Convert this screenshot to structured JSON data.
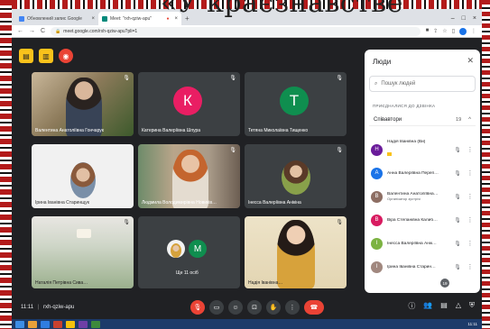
{
  "heading_overlay": "«У краєзнавстве",
  "browser": {
    "tabs": [
      {
        "label": "Обновлений запис Google",
        "active": false,
        "color": "#4285f4"
      },
      {
        "label": "Meet: \"rxh-qziw-apu\"",
        "active": true,
        "color": "#00897b"
      }
    ],
    "url": "meet.google.com/rxh-qziw-apu?pli=1"
  },
  "tiles": [
    {
      "name": "Валентина Анатоліївна Гончарук",
      "type": "video"
    },
    {
      "name": "Катерина Валеріївна Шпура",
      "type": "avatar",
      "initial": "К",
      "color": "#e91e63"
    },
    {
      "name": "Тетяна Миколаївна Тищенко",
      "type": "avatar",
      "initial": "Т",
      "color": "#0f8e4f"
    },
    {
      "name": "Ірина Іванівна Старинщук",
      "type": "video"
    },
    {
      "name": "Людмила Володимирівна Новиків…",
      "type": "video"
    },
    {
      "name": "Інесса Валеріївна Анікіна",
      "type": "video"
    },
    {
      "name": "Наталія Петрівна Сива…",
      "type": "video"
    },
    {
      "name": "Ще 11 осіб",
      "type": "more",
      "initial": "M",
      "color": "#0f8e4f"
    },
    {
      "name": "Надія Іванівна…",
      "type": "video"
    }
  ],
  "panel": {
    "title": "Люди",
    "search_placeholder": "Пошук людей",
    "section": "ПРИЄДНАЛИСЯ ДО ДЗВІНКА",
    "group_label": "Співавтори",
    "group_count": "19",
    "people": [
      {
        "name": "Надія Іванівна (Ви)",
        "initial": "Н",
        "color": "#6a1b9a",
        "host": true
      },
      {
        "name": "Анна Валеріївна Переп…",
        "initial": "А",
        "color": "#1a73e8"
      },
      {
        "name": "Валентина Анатоліївна…",
        "sub": "Організатор зустрічі",
        "initial": "В",
        "color": "#8d6e63"
      },
      {
        "name": "Віра Степанівна Калиб…",
        "initial": "В",
        "color": "#d81b60"
      },
      {
        "name": "Інесса Валеріївна Анік…",
        "initial": "І",
        "color": "#7cb342"
      },
      {
        "name": "Ірина Іванівна Старин…",
        "initial": "І",
        "color": "#a1887f"
      }
    ]
  },
  "bottom": {
    "time": "11:11",
    "separator": "|",
    "meeting_code": "rxh-qziw-apu",
    "people_count": "19"
  },
  "taskbar": {
    "clock": "11:11"
  }
}
